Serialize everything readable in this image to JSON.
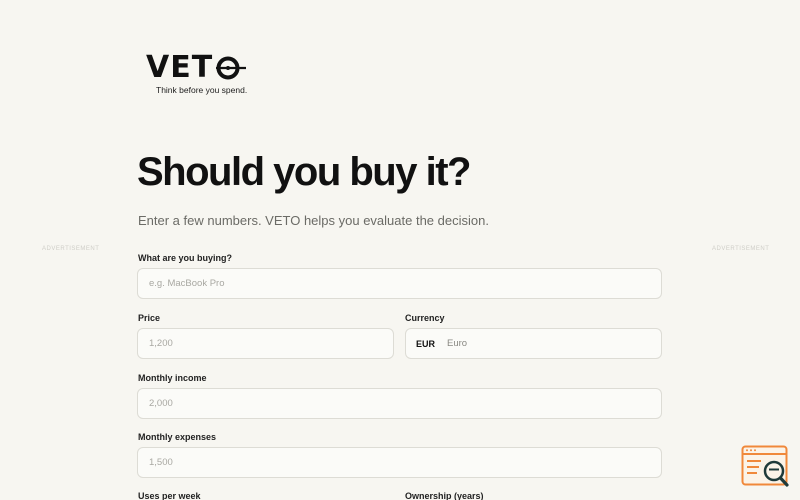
{
  "logo": {
    "wordmark": "VETO",
    "tagline": "Think before you spend."
  },
  "ads": {
    "left": "ADVERTISEMENT",
    "right": "ADVERTISEMENT"
  },
  "hero": {
    "title": "Should you buy it?",
    "subtitle": "Enter a few numbers. VETO helps you evaluate the decision."
  },
  "form": {
    "item": {
      "label": "What are you buying?",
      "placeholder": "e.g. MacBook Pro",
      "value": ""
    },
    "price": {
      "label": "Price",
      "placeholder": "1,200",
      "value": ""
    },
    "currency": {
      "label": "Currency",
      "code": "EUR",
      "name": "Euro"
    },
    "income": {
      "label": "Monthly income",
      "placeholder": "2,000",
      "value": ""
    },
    "expenses": {
      "label": "Monthly expenses",
      "placeholder": "1,500",
      "value": ""
    },
    "uses": {
      "label": "Uses per week"
    },
    "ownership": {
      "label": "Ownership (years)"
    }
  },
  "colors": {
    "background": "#f7f6f1",
    "helper_icon_accent": "#f0883a",
    "helper_icon_dark": "#1f3a3a"
  },
  "icons": {
    "logo_target": "target-icon",
    "helper": "search-window-icon"
  }
}
